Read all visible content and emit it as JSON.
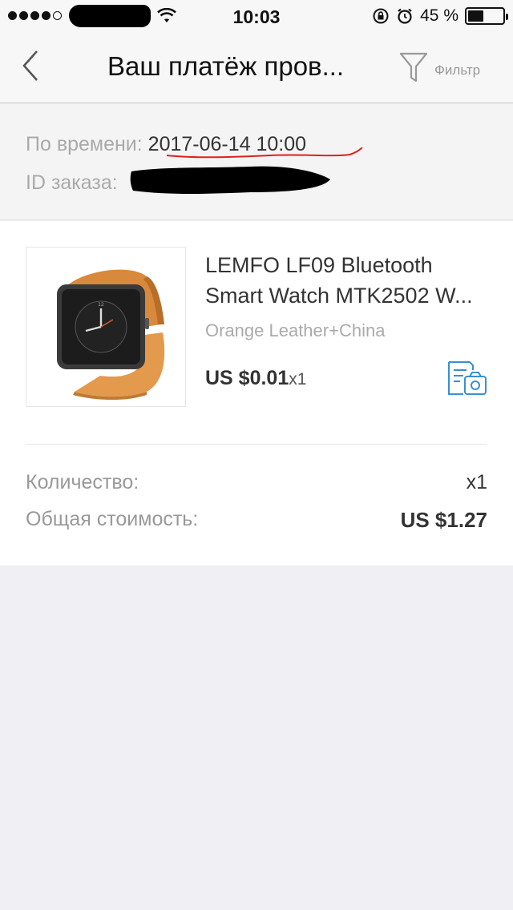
{
  "status_bar": {
    "time": "10:03",
    "battery_text": "45 %",
    "battery_level": 0.45,
    "signal_bars_filled": 4,
    "signal_bars_total": 5
  },
  "nav": {
    "title": "Ваш платёж пров...",
    "filter_label": "Фильтр"
  },
  "info": {
    "time_label": "По времени:",
    "time_value": "2017-06-14 10:00",
    "order_id_label": "ID заказа:"
  },
  "product": {
    "title": "LEMFO LF09 Bluetooth Smart Watch MTK2502 W...",
    "variant": "Orange Leather+China",
    "price": "US $0.01",
    "quantity": "x1"
  },
  "summary": {
    "quantity_label": "Количество:",
    "quantity_value": "x1",
    "total_label": "Общая стоимость:",
    "total_value": "US $1.27"
  },
  "colors": {
    "accent_blue": "#3a8fd0",
    "annotation_red": "#e02020"
  }
}
